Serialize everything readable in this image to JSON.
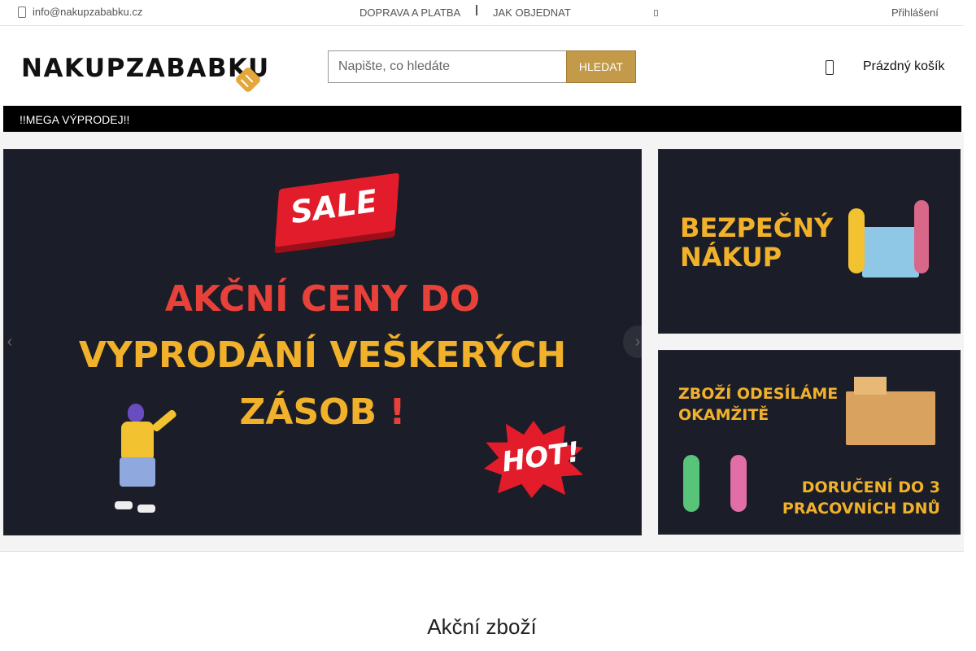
{
  "topbar": {
    "email": "info@nakupzababku.cz",
    "nav": [
      "DOPRAVA A PLATBA",
      "JAK OBJEDNAT"
    ],
    "login": "Přihlášení"
  },
  "header": {
    "logo": "NAKUPZABABKU",
    "search": {
      "placeholder": "Napište, co hledáte",
      "button": "HLEDAT"
    },
    "cart": "Prázdný košík"
  },
  "menubar": {
    "item": "!!MEGA VÝPRODEJ!!"
  },
  "slider": {
    "badge_sale": "SALE",
    "line1": "AKČNÍ CENY DO",
    "line2": "VYPRODÁNÍ VEŠKERÝCH",
    "line3": "ZÁSOB",
    "line3_mark": "!",
    "badge_hot": "HOT!",
    "prev_icon": "chevron-left-icon",
    "next_icon": "chevron-right-icon"
  },
  "side_banners": [
    {
      "line1": "BEZPEČNÝ",
      "line2": "NÁKUP"
    },
    {
      "top1": "ZBOŽÍ ODESÍLÁME",
      "top2": "OKAMŽITĚ",
      "bottom1": "DORUČENÍ DO 3",
      "bottom2": "PRACOVNÍCH DNŮ"
    }
  ],
  "section": {
    "title": "Akční zboží"
  },
  "colors": {
    "accent": "#c29a4a",
    "banner_bg": "#1b1e28",
    "headline_red": "#e8413a",
    "headline_yellow": "#f1b12a",
    "menubar": "#000000"
  }
}
